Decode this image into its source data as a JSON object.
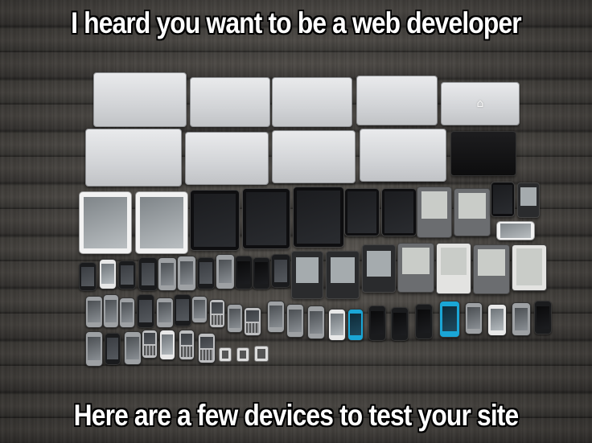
{
  "meme": {
    "top_caption": "I heard you want to be a web developer",
    "bottom_caption": "Here are a few devices to test your site",
    "logo_glyph": "",
    "colors": {
      "caption_text": "#ffffff",
      "caption_outline": "#000000",
      "wood_background": "#4a4743"
    }
  }
}
